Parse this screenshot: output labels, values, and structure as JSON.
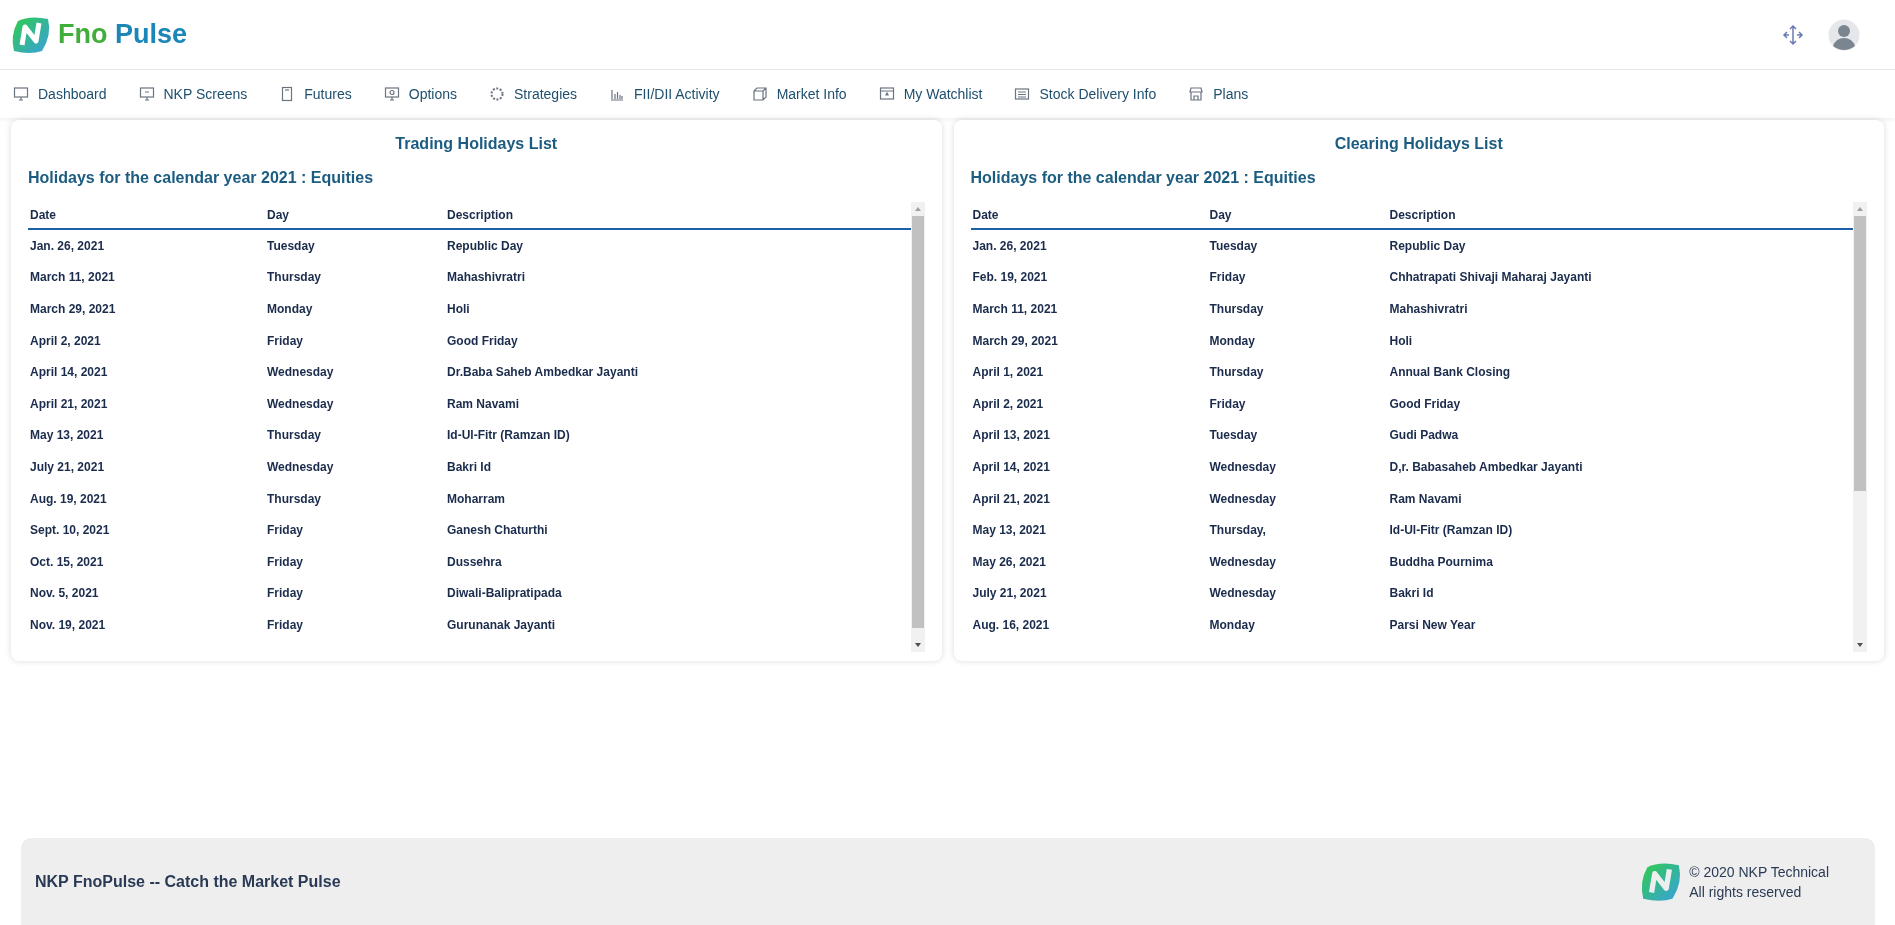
{
  "brand": {
    "part_1": "Fno",
    "part_2": "Pulse"
  },
  "nav": [
    {
      "label": "Dashboard"
    },
    {
      "label": "NKP Screens"
    },
    {
      "label": "Futures"
    },
    {
      "label": "Options"
    },
    {
      "label": "Strategies"
    },
    {
      "label": "FII/DII Activity"
    },
    {
      "label": "Market Info"
    },
    {
      "label": "My Watchlist"
    },
    {
      "label": "Stock Delivery Info"
    },
    {
      "label": "Plans"
    }
  ],
  "panels": [
    {
      "title": "Trading Holidays List",
      "subtitle": "Holidays for the calendar year 2021 : Equities",
      "columns": [
        "Date",
        "Day",
        "Description"
      ],
      "rows": [
        [
          "Jan. 26, 2021",
          "Tuesday",
          "Republic Day"
        ],
        [
          "March 11, 2021",
          "Thursday",
          "Mahashivratri"
        ],
        [
          "March 29, 2021",
          "Monday",
          "Holi"
        ],
        [
          "April 2, 2021",
          "Friday",
          "Good Friday"
        ],
        [
          "April 14, 2021",
          "Wednesday",
          "Dr.Baba Saheb Ambedkar Jayanti"
        ],
        [
          "April 21, 2021",
          "Wednesday",
          "Ram Navami"
        ],
        [
          "May 13, 2021",
          "Thursday",
          "Id-Ul-Fitr (Ramzan ID)"
        ],
        [
          "July 21, 2021",
          "Wednesday",
          "Bakri Id"
        ],
        [
          "Aug. 19, 2021",
          "Thursday",
          "Moharram"
        ],
        [
          "Sept. 10, 2021",
          "Friday",
          "Ganesh Chaturthi"
        ],
        [
          "Oct. 15, 2021",
          "Friday",
          "Dussehra"
        ],
        [
          "Nov. 5, 2021",
          "Friday",
          "Diwali-Balipratipada"
        ],
        [
          "Nov. 19, 2021",
          "Friday",
          "Gurunanak Jayanti"
        ]
      ]
    },
    {
      "title": "Clearing Holidays List",
      "subtitle": "Holidays for the calendar year 2021 : Equities",
      "columns": [
        "Date",
        "Day",
        "Description"
      ],
      "rows": [
        [
          "Jan. 26, 2021",
          "Tuesday",
          "Republic Day"
        ],
        [
          "Feb. 19, 2021",
          "Friday",
          "Chhatrapati Shivaji Maharaj Jayanti"
        ],
        [
          "March 11, 2021",
          "Thursday",
          "Mahashivratri"
        ],
        [
          "March 29, 2021",
          "Monday",
          "Holi"
        ],
        [
          "April 1, 2021",
          "Thursday",
          "Annual Bank Closing"
        ],
        [
          "April 2, 2021",
          "Friday",
          "Good Friday"
        ],
        [
          "April 13, 2021",
          "Tuesday",
          "Gudi Padwa"
        ],
        [
          "April 14, 2021",
          "Wednesday",
          "D,r. Babasaheb Ambedkar Jayanti"
        ],
        [
          "April 21, 2021",
          "Wednesday",
          "Ram Navami"
        ],
        [
          "May 13, 2021",
          "Thursday,",
          "Id-Ul-Fitr (Ramzan ID)"
        ],
        [
          "May 26, 2021",
          "Wednesday",
          "Buddha Pournima"
        ],
        [
          "July 21, 2021",
          "Wednesday",
          "Bakri Id"
        ],
        [
          "Aug. 16, 2021",
          "Monday",
          "Parsi New Year"
        ]
      ]
    }
  ],
  "footer": {
    "tagline": "NKP FnoPulse -- Catch the Market Pulse",
    "copyright": "© 2020 NKP Technical",
    "rights": "All rights reserved"
  }
}
